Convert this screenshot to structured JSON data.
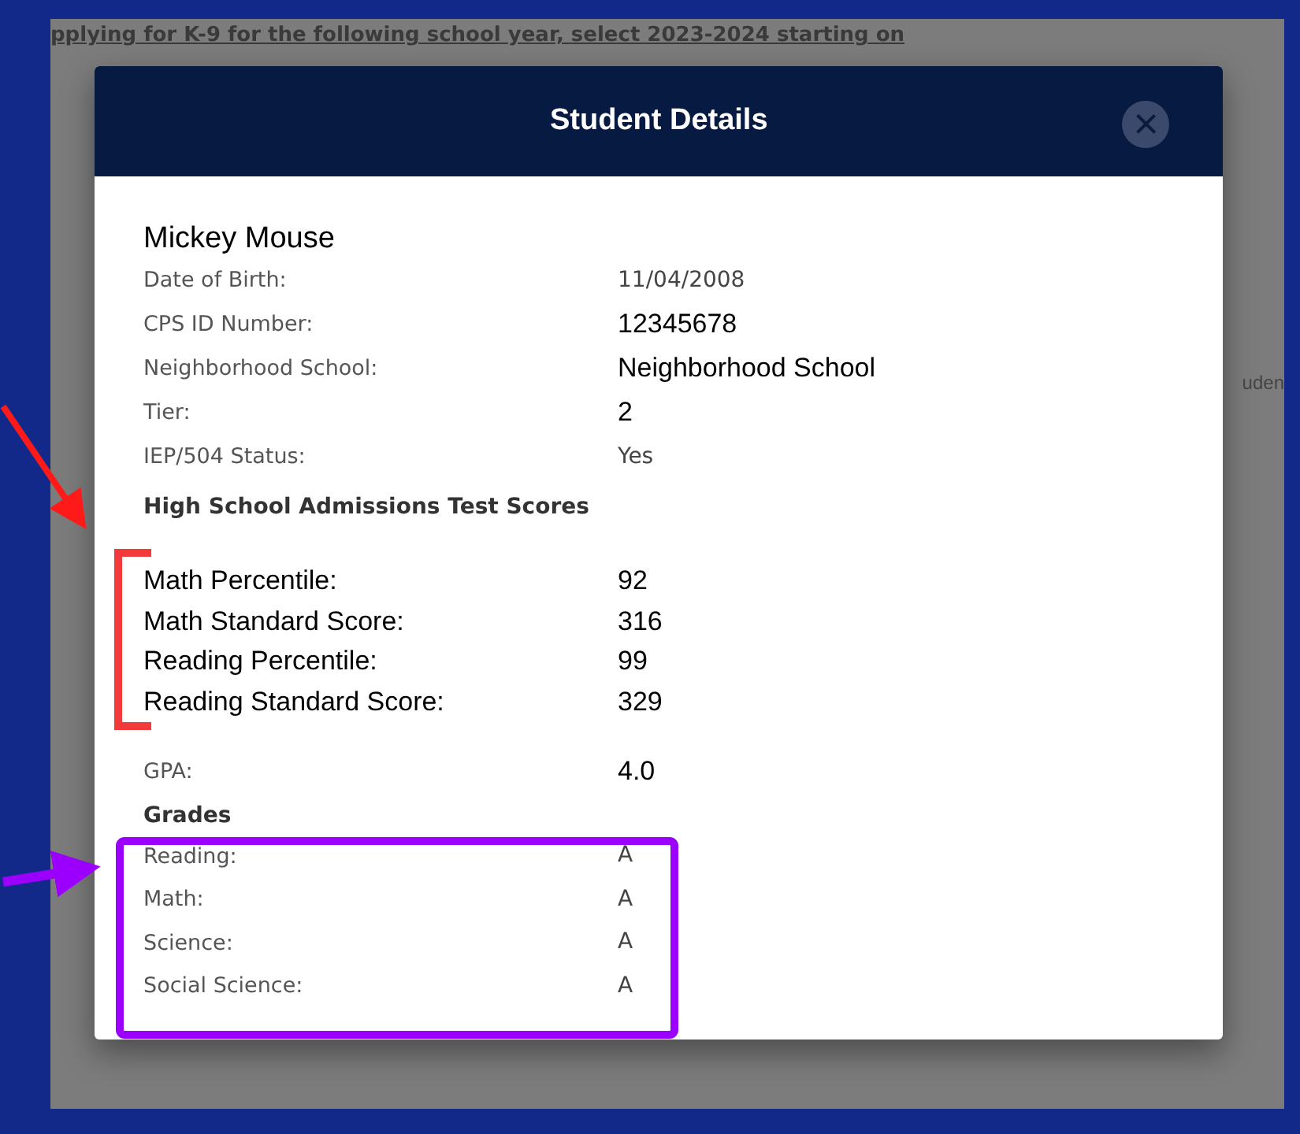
{
  "background": {
    "banner_text": "pplying for K-9 for the following school year, select 2023-2024 starting on",
    "side_fragment": "uden"
  },
  "modal": {
    "title": "Student Details",
    "close_label": "×"
  },
  "student": {
    "name": "Mickey Mouse"
  },
  "details": [
    {
      "kind": "muted",
      "label": "Date of Birth:",
      "value": "11/04/2008"
    },
    {
      "kind": "mixed",
      "label": "CPS ID Number:",
      "value": "12345678"
    },
    {
      "kind": "mixed",
      "label": "Neighborhood School:",
      "value": "Neighborhood School"
    },
    {
      "kind": "mixed",
      "label": "Tier:",
      "value": "2"
    },
    {
      "kind": "muted",
      "label": "IEP/504 Status:",
      "value": "Yes"
    },
    {
      "kind": "heading",
      "label": "High School Admissions Test Scores"
    },
    {
      "kind": "score",
      "label": "Math Percentile:",
      "value": "92"
    },
    {
      "kind": "score",
      "label": "Math Standard Score:",
      "value": "316"
    },
    {
      "kind": "score",
      "label": "Reading Percentile:",
      "value": "99"
    },
    {
      "kind": "score",
      "label": "Reading Standard Score:",
      "value": "329"
    },
    {
      "kind": "mixed",
      "label": "GPA:",
      "value": "4.0"
    },
    {
      "kind": "heading",
      "label": "Grades"
    },
    {
      "kind": "grade",
      "label": "Reading:",
      "value": "A"
    },
    {
      "kind": "grade",
      "label": "Math:",
      "value": "A"
    },
    {
      "kind": "grade",
      "label": "Science:",
      "value": "A"
    },
    {
      "kind": "grade",
      "label": "Social Science:",
      "value": "A"
    }
  ]
}
